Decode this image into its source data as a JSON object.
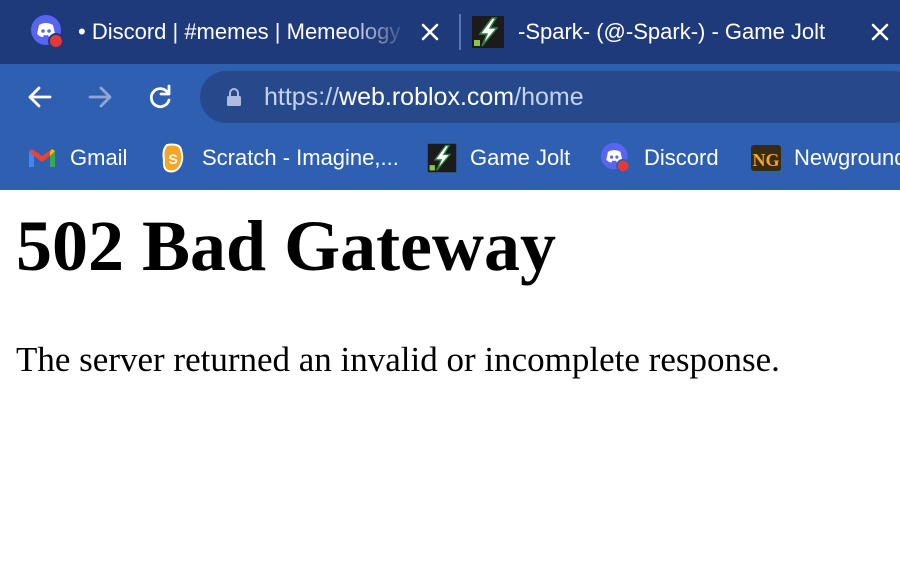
{
  "tabs": [
    {
      "title": "• Discord | #memes | Memeology",
      "favicon": "discord-icon"
    },
    {
      "title": "-Spark- (@-Spark-) - Game Jolt",
      "favicon": "gamejolt-icon"
    }
  ],
  "toolbar": {
    "url": {
      "scheme": "https://",
      "host": "web.roblox.com",
      "path": "/home"
    }
  },
  "bookmarks": [
    {
      "label": "Gmail",
      "icon": "gmail-icon"
    },
    {
      "label": "Scratch - Imagine,...",
      "icon": "scratch-icon"
    },
    {
      "label": "Game Jolt",
      "icon": "gamejolt-icon"
    },
    {
      "label": "Discord",
      "icon": "discord-icon"
    },
    {
      "label": "Newgrounds",
      "icon": "newgrounds-icon"
    }
  ],
  "page": {
    "heading": "502 Bad Gateway",
    "message": "The server returned an invalid or incomplete response."
  },
  "colors": {
    "tabstrip": "#1e3a7a",
    "toolbar": "#2f5fb0",
    "omnibox": "#26498c",
    "discord": "#5865f2"
  }
}
